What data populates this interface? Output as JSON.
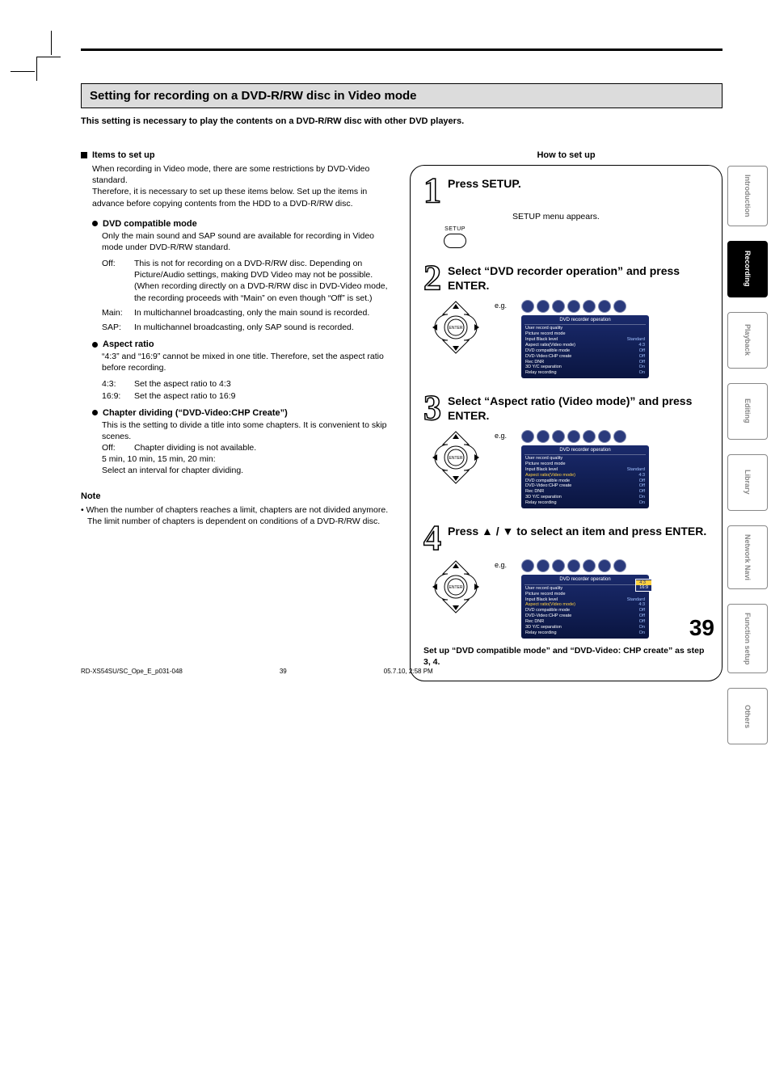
{
  "page": {
    "number": "39",
    "footer_left": "RD-XS54SU/SC_Ope_E_p031-048",
    "footer_mid": "39",
    "footer_right": "05.7.10, 2:58 PM"
  },
  "title": "Setting for recording on a DVD-R/RW disc in Video mode",
  "intro": "This setting is necessary to play the contents on a DVD-R/RW disc with other DVD players.",
  "left": {
    "items_head": "Items to set up",
    "items_body": "When recording in Video mode, there are some restrictions by DVD-Video standard.\nTherefore, it is necessary to set up these items below. Set up the items in advance before copying contents from the HDD to a DVD-R/RW disc.",
    "dvd_compat_head": "DVD compatible mode",
    "dvd_compat_body": "Only the main sound and SAP sound are available for recording in Video mode under DVD-R/RW standard.",
    "off_label": "Off:",
    "off_text": "This is not for recording on a DVD-R/RW disc. Depending on Picture/Audio settings, making DVD Video may not be possible. (When recording directly on a DVD-R/RW disc in DVD-Video mode, the recording proceeds with “Main” on even though “Off” is set.)",
    "main_label": "Main:",
    "main_text": "In multichannel broadcasting, only the main sound is recorded.",
    "sap_label": "SAP:",
    "sap_text": "In multichannel broadcasting, only SAP sound is recorded.",
    "aspect_head": "Aspect ratio",
    "aspect_body1": "“4:3” and “16:9” cannot be mixed in one title. Therefore, set the aspect ratio before recording.",
    "aspect_43_label": "4:3:",
    "aspect_43_text": "Set the aspect ratio to 4:3",
    "aspect_169_label": "16:9:",
    "aspect_169_text": "Set the aspect ratio to 16:9",
    "chapter_head": "Chapter dividing (“DVD-Video:CHP Create”)",
    "chapter_body": "This is the setting to divide a title into some chapters. It is convenient to skip scenes.",
    "chapter_off_label": "Off:",
    "chapter_off_text": "Chapter dividing is not available.",
    "chapter_intervals": "5 min, 10 min, 15 min, 20 min:",
    "chapter_select": "Select an interval for chapter dividing.",
    "note_head": "Note",
    "note_body": "• When the number of chapters reaches a limit, chapters are not divided anymore. The limit number of chapters is dependent on conditions of a DVD-R/RW disc."
  },
  "right": {
    "howto_head": "How to set up",
    "step1_num": "1",
    "step1_title": "Press SETUP.",
    "step1_sub": "SETUP menu appears.",
    "setup_label": "SETUP",
    "step2_num": "2",
    "step2_title": "Select “DVD recorder operation” and press ENTER.",
    "step3_num": "3",
    "step3_title": "Select “Aspect ratio (Video mode)” and press ENTER.",
    "step4_num": "4",
    "step4_title": "Press ▲ / ▼ to select an item and press ENTER.",
    "eg": "e.g.",
    "enter_label": "ENTER",
    "final_note": "Set up “DVD compatible mode” and “DVD-Video: CHP create” as step 3, 4."
  },
  "osd": {
    "title": "DVD recorder operation",
    "rows": [
      {
        "k": "User record quality",
        "v": ""
      },
      {
        "k": "Picture record mode",
        "v": ""
      },
      {
        "k": "Input Black level",
        "v": "Standard"
      },
      {
        "k": "Aspect ratio(Video mode)",
        "v": "4:3"
      },
      {
        "k": "DVD compatible mode",
        "v": "Off"
      },
      {
        "k": "DVD-Video:CHP create",
        "v": "Off"
      },
      {
        "k": "Rec DNR",
        "v": "Off"
      },
      {
        "k": "3D Y/C separation",
        "v": "On"
      },
      {
        "k": "Relay recording",
        "v": "On"
      }
    ],
    "popup": [
      "4:3",
      "16:9"
    ]
  },
  "tabs": [
    "Introduction",
    "Recording",
    "Playback",
    "Editing",
    "Library",
    "Network Navi",
    "Function setup",
    "Others"
  ],
  "active_tab_index": 1
}
